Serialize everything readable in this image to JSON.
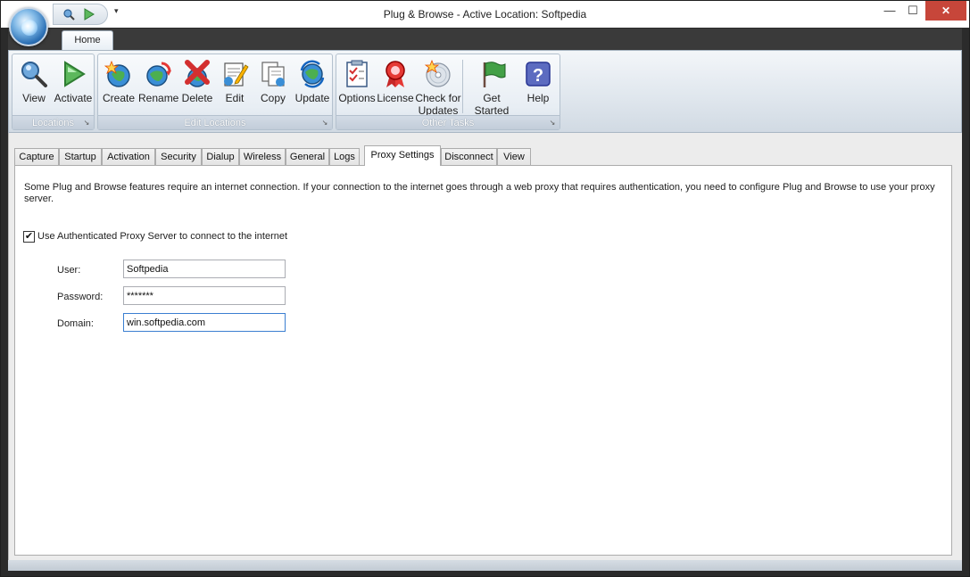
{
  "window": {
    "title": "Plug & Browse - Active Location: Softpedia",
    "controls": {
      "minimize": "—",
      "maximize": "☐",
      "close": "✕"
    }
  },
  "quick_access": {
    "icons": [
      "view-icon",
      "activate-icon"
    ],
    "customize": "▾"
  },
  "ribbon": {
    "tabs": [
      {
        "label": "Home",
        "active": true
      }
    ],
    "groups": {
      "locations": {
        "caption": "Locations",
        "buttons": [
          {
            "label": "View",
            "icon": "view-icon"
          },
          {
            "label": "Activate",
            "icon": "activate-icon"
          }
        ]
      },
      "edit_locations": {
        "caption": "Edit Locations",
        "buttons": [
          {
            "label": "Create",
            "icon": "create-icon"
          },
          {
            "label": "Rename",
            "icon": "rename-icon"
          },
          {
            "label": "Delete",
            "icon": "delete-icon"
          },
          {
            "label": "Edit",
            "icon": "edit-icon"
          },
          {
            "label": "Copy",
            "icon": "copy-icon"
          },
          {
            "label": "Update",
            "icon": "update-icon"
          }
        ]
      },
      "other_tasks": {
        "caption": "Other Tasks",
        "buttons": [
          {
            "label": "Options",
            "icon": "options-icon"
          },
          {
            "label": "License",
            "icon": "license-icon"
          },
          {
            "label": "Check for",
            "label2": "Updates",
            "icon": "check-updates-icon"
          },
          {
            "label": "Get Started",
            "icon": "get-started-icon"
          },
          {
            "label": "Help",
            "icon": "help-icon"
          }
        ]
      }
    },
    "launcher_glyph": "↘"
  },
  "settings_tabs": [
    {
      "label": "Capture"
    },
    {
      "label": "Startup"
    },
    {
      "label": "Activation"
    },
    {
      "label": "Security"
    },
    {
      "label": "Dialup"
    },
    {
      "label": "Wireless"
    },
    {
      "label": "General"
    },
    {
      "label": "Logs"
    },
    {
      "label": "Proxy Settings",
      "active": true
    },
    {
      "label": "Disconnect"
    },
    {
      "label": "View"
    }
  ],
  "proxy": {
    "intro": "Some Plug and Browse features require an internet connection. If your connection to the internet goes through a web proxy that requires authentication, you need to configure Plug and Browse to use your proxy server.",
    "use_proxy_label": "Use Authenticated Proxy Server to connect to the internet",
    "use_proxy_checked": true,
    "check_glyph": "✔",
    "fields": {
      "user": {
        "label": "User:",
        "value": "Softpedia"
      },
      "password": {
        "label": "Password:",
        "value": "*******"
      },
      "domain": {
        "label": "Domain:",
        "value": "win.softpedia.com"
      }
    }
  },
  "colors": {
    "accent": "#3b7fd1",
    "close_button": "#c7463a",
    "ribbon_bg": "#dfe6ed"
  }
}
